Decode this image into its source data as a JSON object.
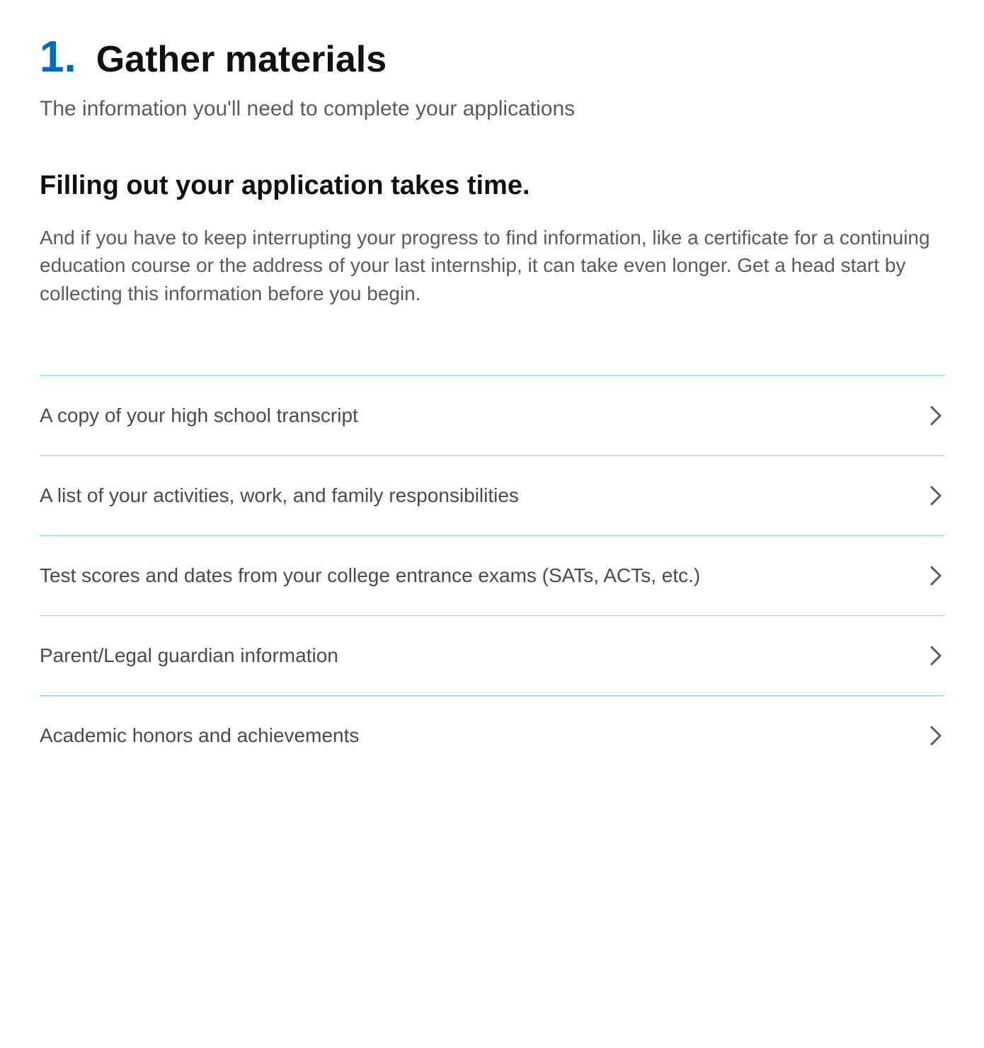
{
  "header": {
    "number": "1.",
    "title": "Gather materials",
    "subtitle": "The information you'll need to complete your applications"
  },
  "section": {
    "heading": "Filling out your application takes time.",
    "body": "And if you have to keep interrupting your progress to find information, like a certificate for a continuing education course or the address of your last internship, it can take even longer. Get a head start by collecting this information before you begin."
  },
  "accordion": {
    "items": [
      {
        "label": "A copy of your high school transcript"
      },
      {
        "label": "A list of your activities, work, and family responsibilities"
      },
      {
        "label": "Test scores and dates from your college entrance exams (SATs, ACTs, etc.)"
      },
      {
        "label": "Parent/Legal guardian information"
      },
      {
        "label": "Academic honors and achievements"
      }
    ]
  }
}
